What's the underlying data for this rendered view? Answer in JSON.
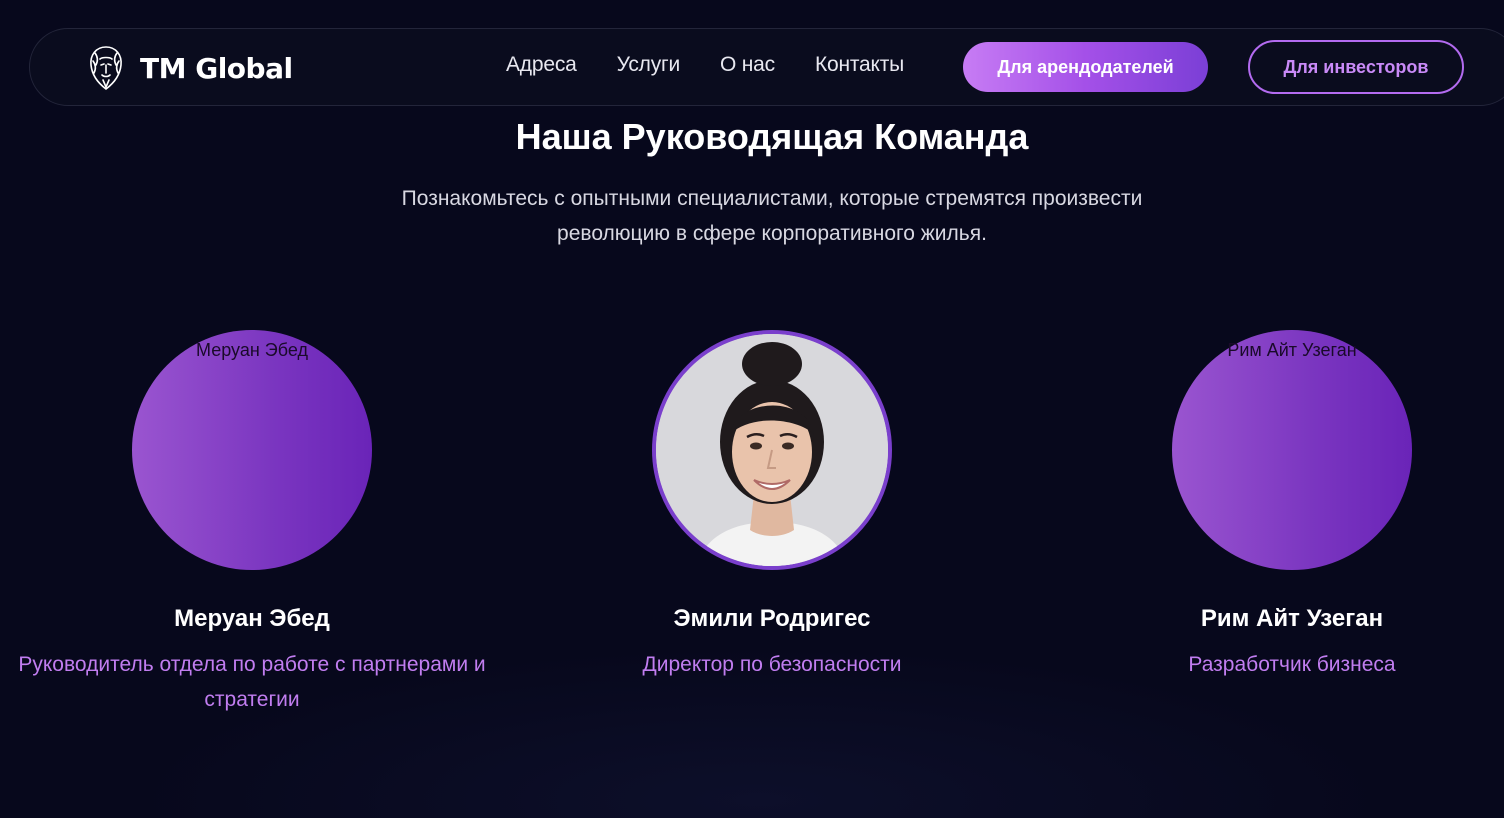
{
  "brand": {
    "name": "TM Global",
    "logo_icon": "lion-head-icon"
  },
  "nav": {
    "links": [
      "Адреса",
      "Услуги",
      "О нас",
      "Контакты"
    ],
    "landlords_button": "Для арендодателей",
    "investors_button": "Для инвесторов"
  },
  "section": {
    "title": "Наша Руководящая Команда",
    "subtitle": "Познакомьтесь с опытными специалистами, которые стремятся произвести революцию в сфере корпоративного жилья."
  },
  "team": [
    {
      "name": "Меруан Эбед",
      "role": "Руководитель отдела по работе с партнерами и стратегии",
      "image_alt": "Меруан Эбед"
    },
    {
      "name": "Эмили Родригес",
      "role": "Директор по безопасности"
    },
    {
      "name": "Рим Айт Узеган",
      "role": "Разработчик бизнеса",
      "image_alt": "Рим Айт Узеган"
    }
  ],
  "colors": {
    "background": "#07081c",
    "accent": "#a450e8",
    "role_text": "#c17df0"
  }
}
